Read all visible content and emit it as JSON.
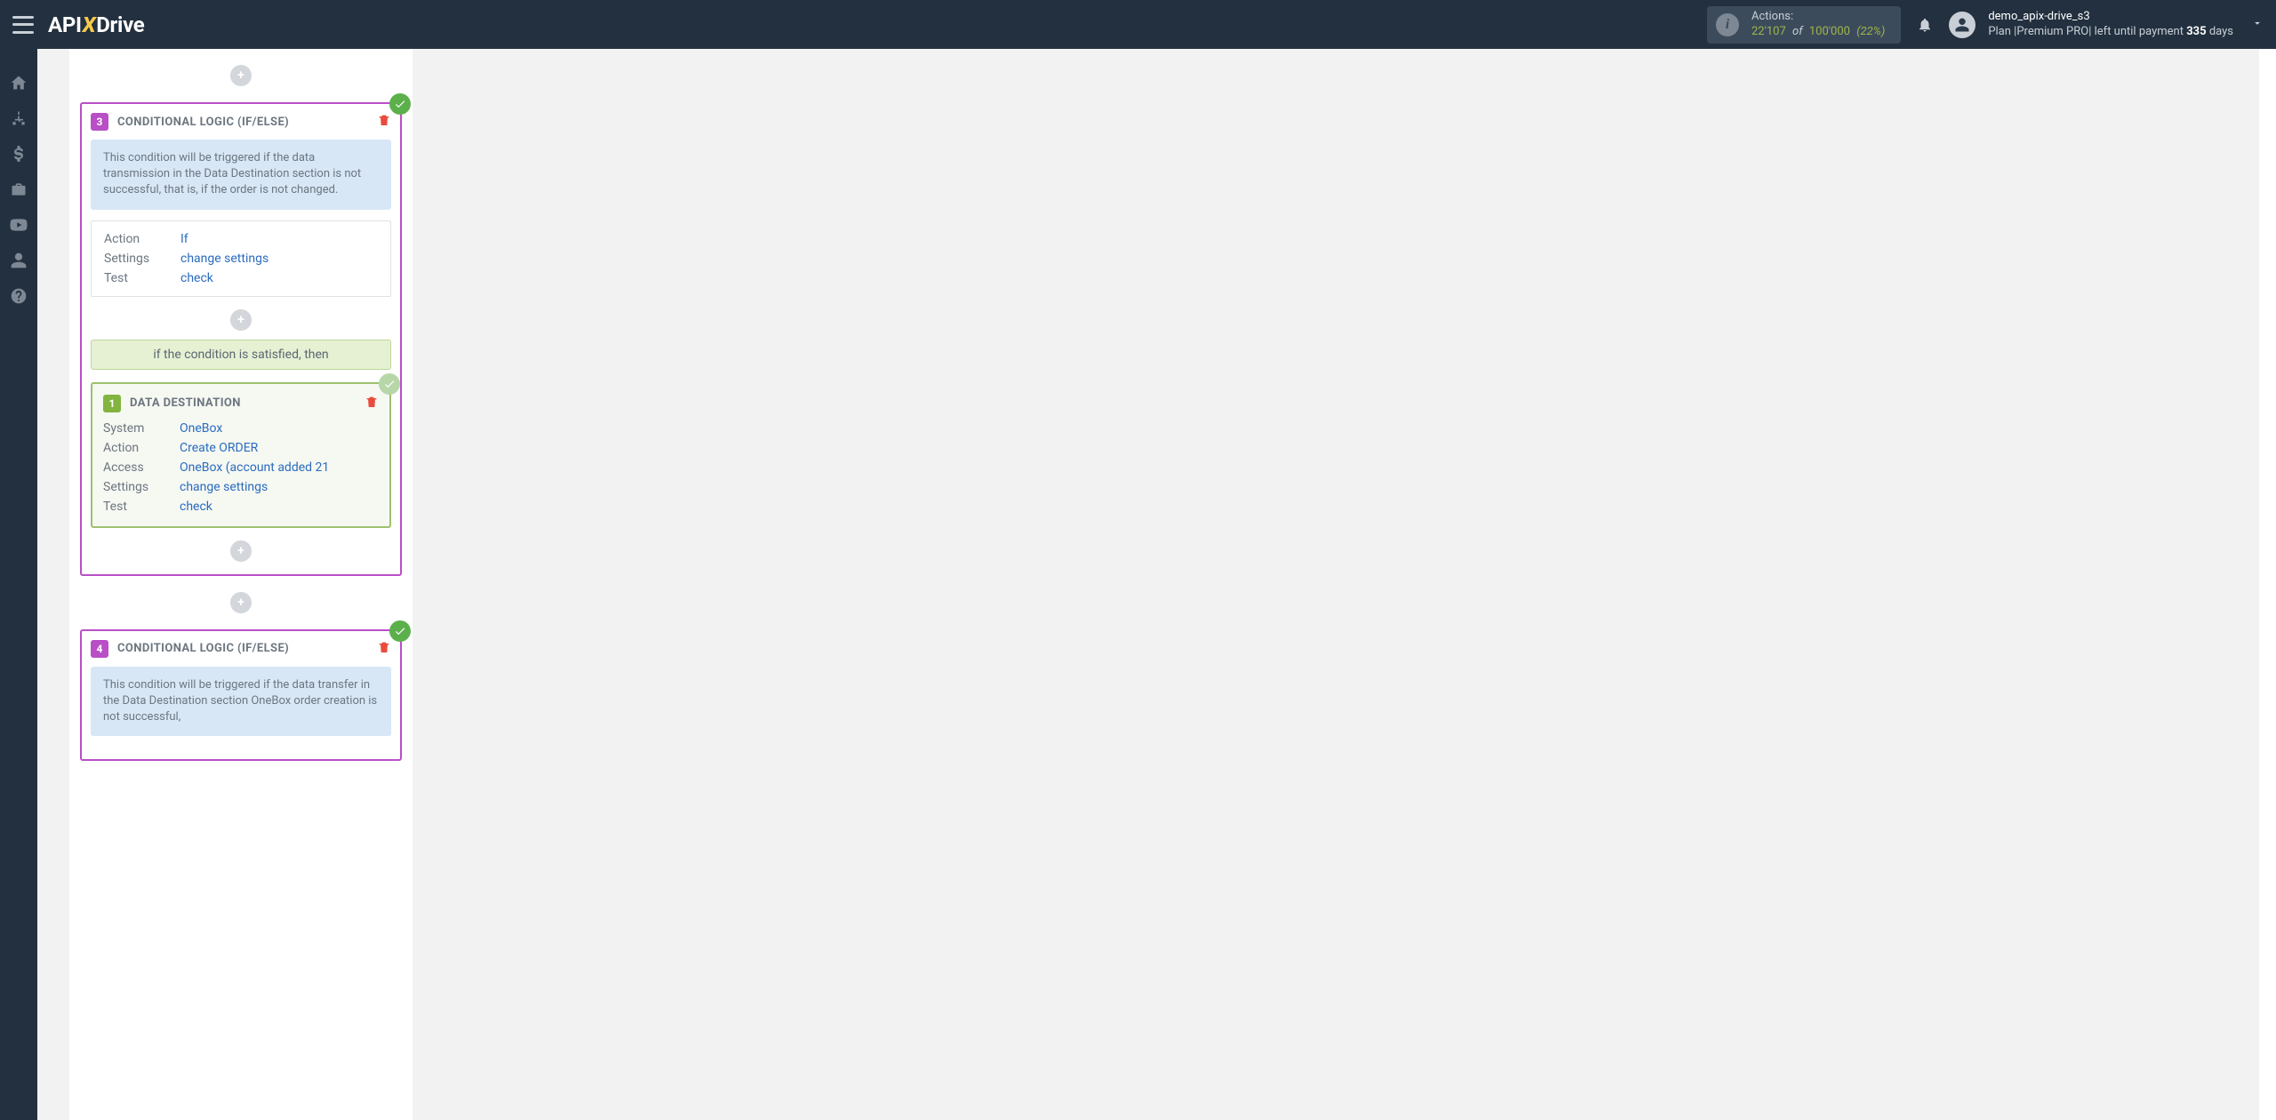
{
  "header": {
    "actions_label": "Actions:",
    "actions_used": "22'107",
    "actions_of": "of",
    "actions_total": "100'000",
    "actions_pct": "(22%)",
    "user_name": "demo_apix-drive_s3",
    "plan_prefix": "Plan |",
    "plan_name": "Premium PRO",
    "plan_mid": "| left until payment ",
    "plan_days": "335",
    "plan_suffix": " days"
  },
  "sidebar": {
    "items": [
      "home",
      "sitemap",
      "dollar",
      "briefcase",
      "youtube",
      "user",
      "help"
    ]
  },
  "card3": {
    "num": "3",
    "title": "CONDITIONAL LOGIC (IF/ELSE)",
    "note": "This condition will be triggered if the data transmission in the Data Destination section is not successful, that is, if the order is not changed.",
    "rows": {
      "action_k": "Action",
      "action_v": "If",
      "settings_k": "Settings",
      "settings_v": "change settings",
      "test_k": "Test",
      "test_v": "check"
    },
    "satisfied": "if the condition is satisfied, then",
    "nested": {
      "num": "1",
      "title": "DATA DESTINATION",
      "rows": {
        "system_k": "System",
        "system_v": "OneBox",
        "action_k": "Action",
        "action_v": "Create ORDER",
        "access_k": "Access",
        "access_v": "OneBox (account added 21",
        "settings_k": "Settings",
        "settings_v": "change settings",
        "test_k": "Test",
        "test_v": "check"
      }
    }
  },
  "card4": {
    "num": "4",
    "title": "CONDITIONAL LOGIC (IF/ELSE)",
    "note": "This condition will be triggered if the data transfer in the Data Destination section OneBox order creation is not successful,"
  }
}
